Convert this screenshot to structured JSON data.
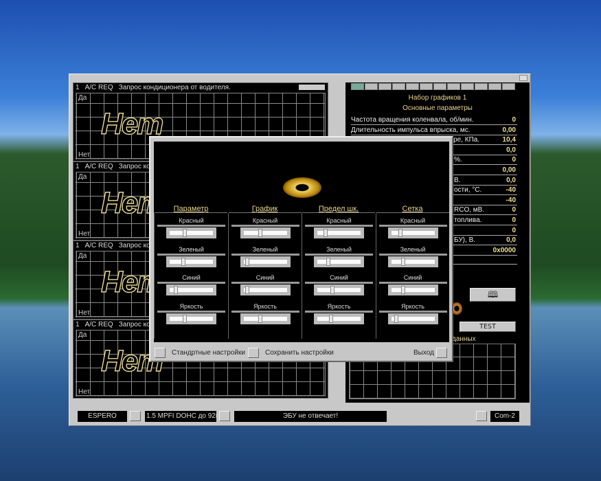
{
  "charts": [
    {
      "num": "1",
      "code": "A/C REQ",
      "desc": "Запрос кондиционера от водителя.",
      "top": "Да",
      "bottom": "Нет",
      "value": "Нет"
    },
    {
      "num": "1",
      "code": "A/C REQ",
      "desc": "Запрос конд",
      "top": "Да",
      "bottom": "Нет",
      "value": "Нет"
    },
    {
      "num": "1",
      "code": "A/C REQ",
      "desc": "Запрос конд",
      "top": "Да",
      "bottom": "Нет",
      "value": "Нет"
    },
    {
      "num": "1",
      "code": "A/C REQ",
      "desc": "Запрос конд",
      "top": "Да",
      "bottom": "Нет",
      "value": "Нет"
    }
  ],
  "right": {
    "set_title": "Набор графиков 1",
    "group_title": "Основные параметры",
    "params": [
      {
        "label": "Частота вращения коленвала, об/мин.",
        "value": "0"
      },
      {
        "label": "Длительность импульса впрыска, мс.",
        "value": "0,00"
      },
      {
        "label": "Давление во впускном коллекторе, КПа.",
        "value": "10,4"
      },
      {
        "label": "",
        "value": "0,0"
      },
      {
        "label": "%.",
        "value": "0"
      },
      {
        "label": "",
        "value": "0,00"
      },
      {
        "label": "В.",
        "value": "0,0"
      },
      {
        "label": "ости, °С.",
        "value": "-40"
      },
      {
        "label": "",
        "value": "-40"
      },
      {
        "label": "RCO, мВ.",
        "value": "0"
      },
      {
        "label": "топлива.",
        "value": "0"
      },
      {
        "label": "",
        "value": "0"
      },
      {
        "label": "БУ), В.",
        "value": "0,0"
      },
      {
        "label": "",
        "value": "0x0000"
      }
    ],
    "book_button_icon": "book-icon",
    "test_label": "TEST",
    "data_group_label": "данных"
  },
  "modal": {
    "columns": [
      {
        "title": "Параметр",
        "sliders": [
          {
            "label": "Красный",
            "value": 0.33
          },
          {
            "label": "Зеленый",
            "value": 0.3
          },
          {
            "label": "Синий",
            "value": 0.1
          },
          {
            "label": "Яркость",
            "value": 0.33
          }
        ]
      },
      {
        "title": "График",
        "sliders": [
          {
            "label": "Красный",
            "value": 0.37
          },
          {
            "label": "Зеленый",
            "value": 0.04
          },
          {
            "label": "Синий",
            "value": 0.04
          },
          {
            "label": "Яркость",
            "value": 0.37
          }
        ]
      },
      {
        "title": "Предел шк.",
        "sliders": [
          {
            "label": "Красный",
            "value": 0.15
          },
          {
            "label": "Зеленый",
            "value": 0.22
          },
          {
            "label": "Синий",
            "value": 0.33
          },
          {
            "label": "Яркость",
            "value": 0.3
          }
        ]
      },
      {
        "title": "Сетка",
        "sliders": [
          {
            "label": "Красный",
            "value": 0.18
          },
          {
            "label": "Зеленый",
            "value": 0.25
          },
          {
            "label": "Синий",
            "value": 0.25
          },
          {
            "label": "Яркость",
            "value": 0.08
          }
        ]
      }
    ],
    "default_label": "Стандртные настройки",
    "save_label": "Сохранить настройки",
    "exit_label": "Выход"
  },
  "status": {
    "car": "ESPERO",
    "engine": "1.5 MPFI DOHC до 92г.",
    "message": "ЭБУ не отвечает!",
    "port": "Com-2"
  }
}
